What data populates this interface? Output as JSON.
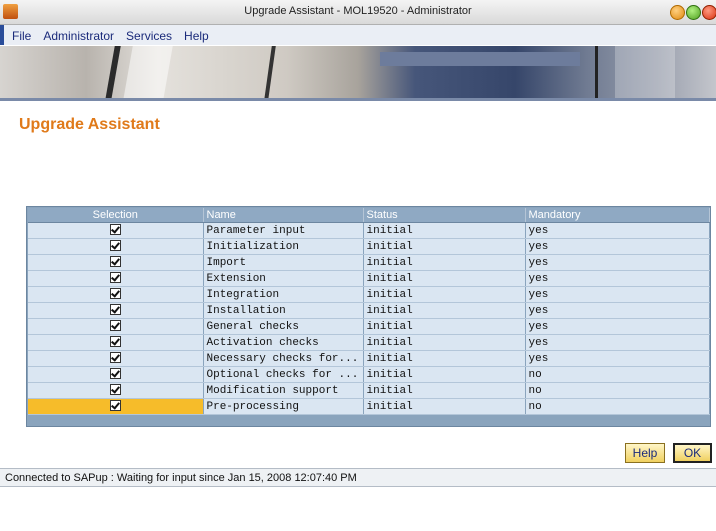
{
  "window": {
    "title": "Upgrade Assistant - MOL19520 - Administrator"
  },
  "menu": {
    "items": [
      "File",
      "Administrator",
      "Services",
      "Help"
    ]
  },
  "page": {
    "title": "Upgrade Assistant"
  },
  "table": {
    "columns": [
      "Selection",
      "Name",
      "Status",
      "Mandatory"
    ],
    "rows": [
      {
        "checked": true,
        "name": "Parameter input",
        "status": "initial",
        "mandatory": "yes"
      },
      {
        "checked": true,
        "name": "Initialization",
        "status": "initial",
        "mandatory": "yes"
      },
      {
        "checked": true,
        "name": "Import",
        "status": "initial",
        "mandatory": "yes"
      },
      {
        "checked": true,
        "name": "Extension",
        "status": "initial",
        "mandatory": "yes"
      },
      {
        "checked": true,
        "name": "Integration",
        "status": "initial",
        "mandatory": "yes"
      },
      {
        "checked": true,
        "name": "Installation",
        "status": "initial",
        "mandatory": "yes"
      },
      {
        "checked": true,
        "name": "General checks",
        "status": "initial",
        "mandatory": "yes"
      },
      {
        "checked": true,
        "name": "Activation checks",
        "status": "initial",
        "mandatory": "yes"
      },
      {
        "checked": true,
        "name": "Necessary checks for...",
        "status": "initial",
        "mandatory": "yes"
      },
      {
        "checked": true,
        "name": "Optional checks for ...",
        "status": "initial",
        "mandatory": "no"
      },
      {
        "checked": true,
        "name": "Modification support",
        "status": "initial",
        "mandatory": "no"
      },
      {
        "checked": true,
        "name": "Pre-processing",
        "status": "initial",
        "mandatory": "no"
      }
    ]
  },
  "buttons": {
    "help_label": "Help",
    "ok_label": "OK"
  },
  "status": {
    "text": "Connected to SAPup : Waiting for input since Jan 15, 2008 12:07:40 PM"
  },
  "colors": {
    "title_accent": "#e07a1a",
    "selected_row": "#f6bc2a",
    "table_header": "#8fa9c3",
    "table_cell": "#dae6f2"
  }
}
